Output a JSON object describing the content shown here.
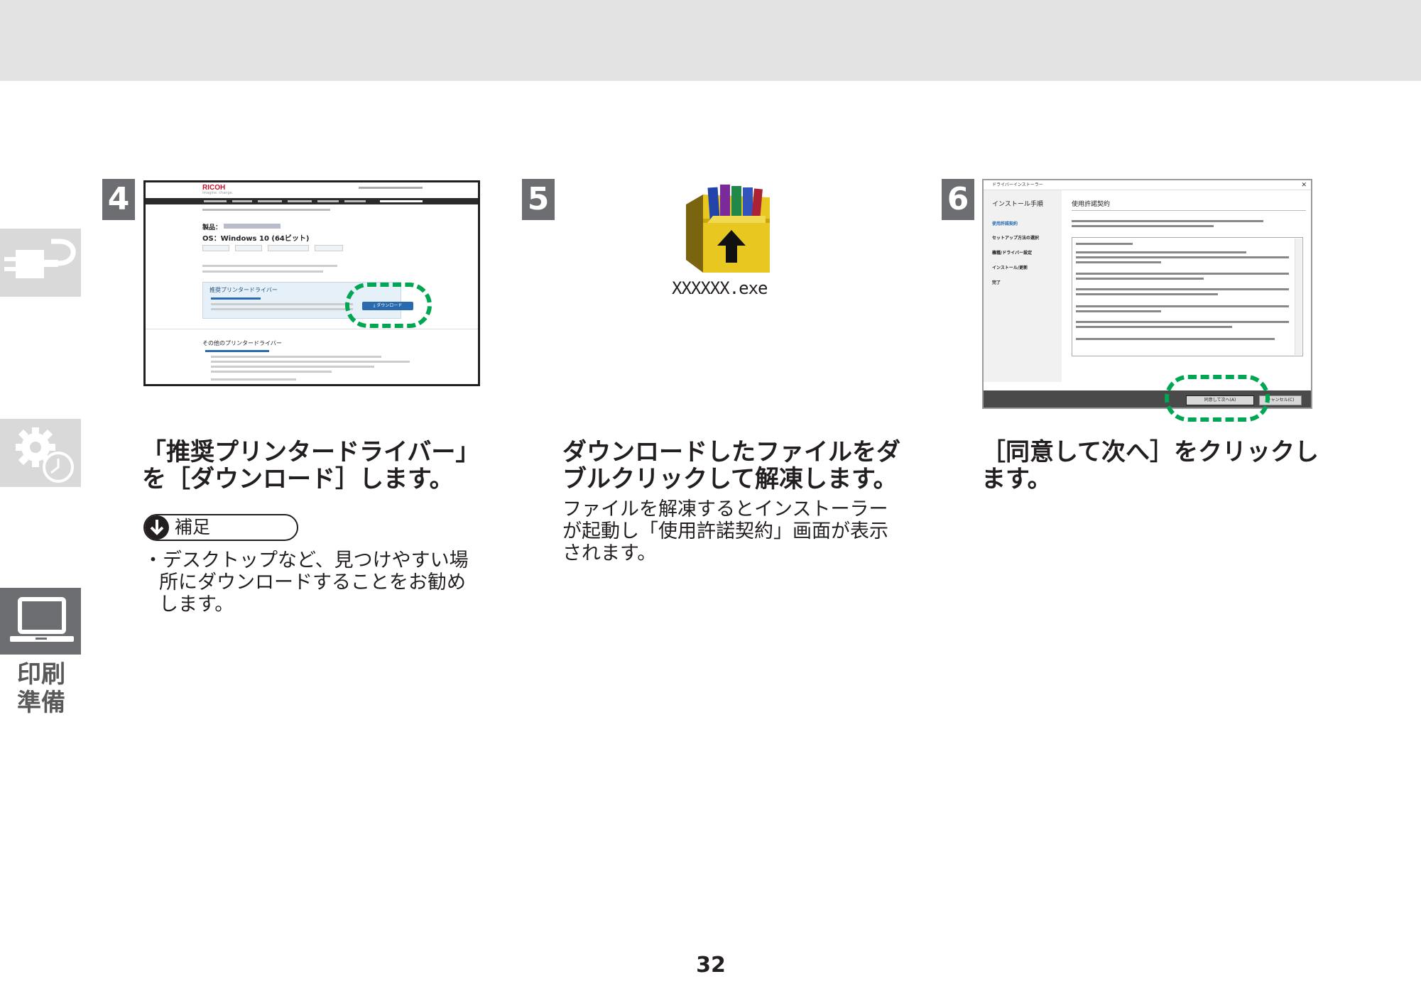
{
  "sidebar": {
    "tabs": [
      {
        "icon": "power-plug-icon",
        "active": false
      },
      {
        "icon": "gear-clock-icon",
        "active": false
      },
      {
        "icon": "laptop-icon",
        "active": true
      }
    ],
    "active_label": "印刷準備"
  },
  "steps": [
    {
      "number": "4",
      "heading_line1": "「推奨プリンタードライバー」",
      "heading_line2": "を［ダウンロード］します。",
      "note_label": "補足",
      "note_bullet_line1": "デスクトップなど、見つけやすい場",
      "note_bullet_line2": "所にダウンロードすることをお勧め",
      "note_bullet_line3": "します。",
      "screenshot": {
        "brand": "RICOH",
        "tagline": "imagine. change.",
        "product_label": "製品：",
        "os_label": "OS：Windows 10 (64ビット)",
        "recommended_title": "推奨プリンタードライバー",
        "download_button": "⤓ ダウンロード",
        "other_title": "その他のプリンタードライバー"
      }
    },
    {
      "number": "5",
      "file_name": "XXXXXX.exe",
      "heading_line1": "ダウンロードしたファイルをダ",
      "heading_line2": "ブルクリックして解凍します。",
      "body_line1": "ファイルを解凍するとインストーラー",
      "body_line2": "が起動し「使用許諾契約」画面が表示",
      "body_line3": "されます。"
    },
    {
      "number": "6",
      "heading_line1": "［同意して次へ］をクリックし",
      "heading_line2": "ます。",
      "dialog": {
        "title": "ドライバーインストーラー",
        "left_heading": "インストール手順",
        "left_items": [
          "使用許諾契約",
          "セットアップ方法の選択",
          "機種/ドライバー設定",
          "インストール/更新",
          "完了"
        ],
        "right_heading": "使用許諾契約",
        "agree_button": "同意して次へ(A)",
        "cancel_button": "キャンセル(C)"
      }
    }
  ],
  "page_number": "32",
  "colors": {
    "highlight_dash": "#00a651",
    "step_badge": "#6d6e71",
    "top_band": "#e3e3e3"
  }
}
